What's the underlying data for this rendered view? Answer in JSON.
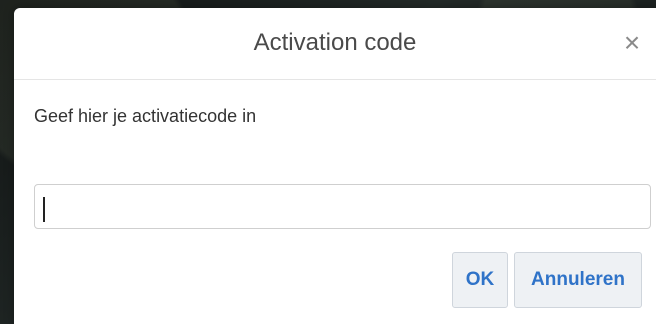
{
  "dialog": {
    "title": "Activation code",
    "close_symbol": "×",
    "prompt": "Geef hier je activatiecode in",
    "input": {
      "value": "",
      "placeholder": ""
    },
    "buttons": {
      "ok": "OK",
      "cancel": "Annuleren"
    }
  },
  "icons": {
    "close": "close-icon"
  },
  "colors": {
    "title_text": "#4a4a4a",
    "body_text": "#333333",
    "button_text": "#2f73c8",
    "button_background": "#eef1f4",
    "border": "#cfcfcf"
  }
}
